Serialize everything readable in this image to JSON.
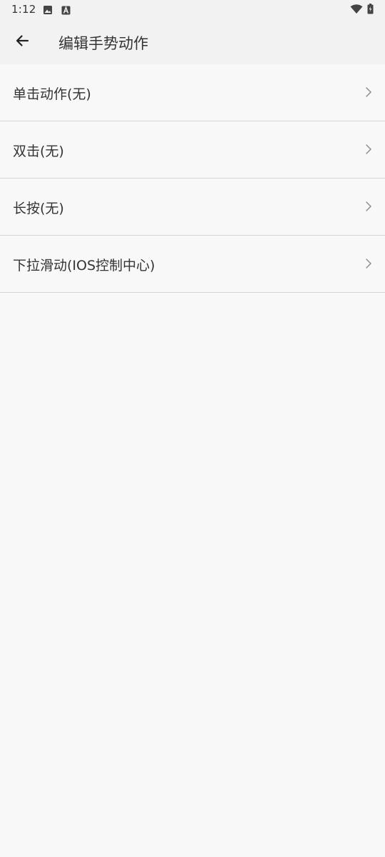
{
  "status_bar": {
    "time": "1:12",
    "icons_left": [
      "image-icon",
      "a-icon"
    ],
    "icons_right": [
      "wifi-icon",
      "battery-icon"
    ]
  },
  "header": {
    "back_icon": "arrow-left-icon",
    "title": "编辑手势动作"
  },
  "list": {
    "items": [
      {
        "label": "单击动作(无)"
      },
      {
        "label": "双击(无)"
      },
      {
        "label": "长按(无)"
      },
      {
        "label": "下拉滑动(IOS控制中心)"
      }
    ],
    "chevron_icon": "chevron-right-icon"
  },
  "colors": {
    "background": "#f8f8f8",
    "app_bar": "#f2f2f2",
    "divider": "#d6d6d6",
    "text": "#333333",
    "chevron": "#888888"
  }
}
